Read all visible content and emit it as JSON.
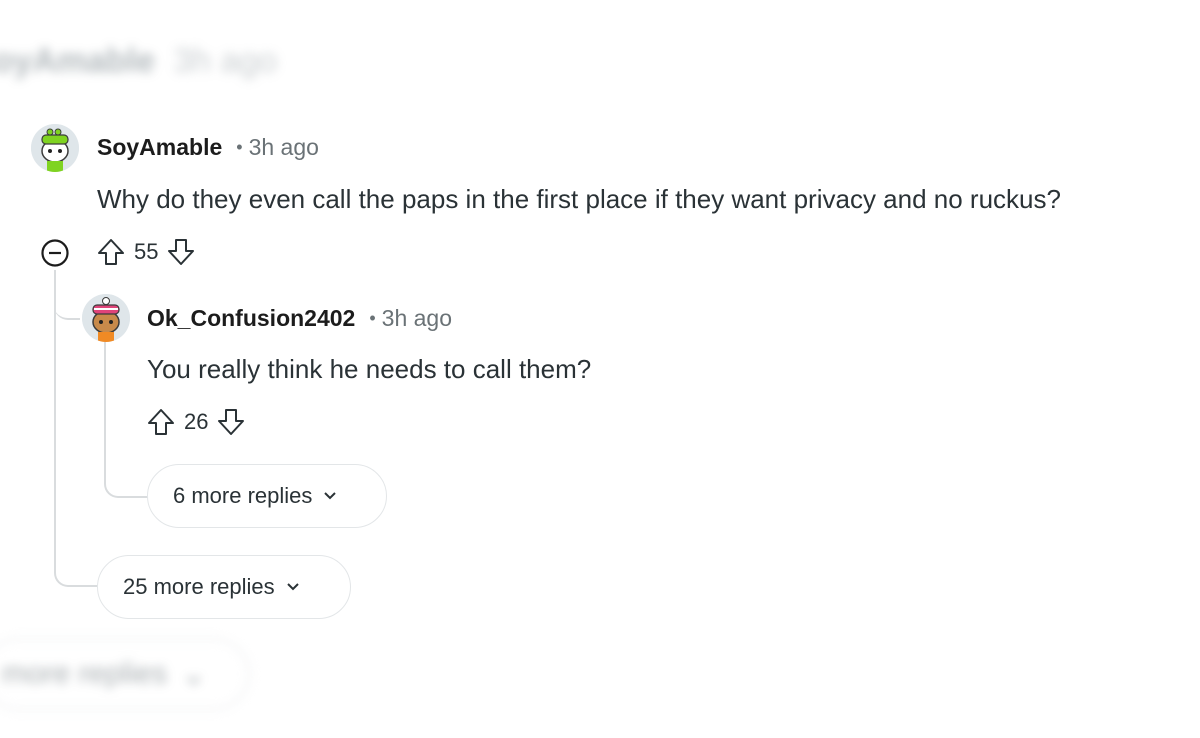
{
  "background_blurred": {
    "top_username": "SoyAmable",
    "top_time": "3h ago",
    "bottom_label": "more replies"
  },
  "comment1": {
    "username": "SoyAmable",
    "separator": "•",
    "time": "3h ago",
    "body": "Why do they even call the paps in the first place if they want privacy and no ruckus?",
    "votes": "55",
    "avatar_icon": "snoo-green-avatar"
  },
  "comment2": {
    "username": "Ok_Confusion2402",
    "separator": "•",
    "time": "3h ago",
    "body": "You really think he needs to call them?",
    "votes": "26",
    "avatar_icon": "snoo-pink-avatar"
  },
  "more_replies_nested": "6 more replies",
  "more_replies_top": "25 more replies",
  "colors": {
    "thread_line": "#d9dcde",
    "text_primary": "#1c1c1c",
    "text_meta": "#6a7276"
  }
}
